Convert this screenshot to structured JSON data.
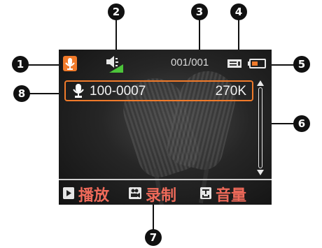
{
  "screen": {
    "counter": "001/001",
    "file": {
      "name": "100-0007",
      "size": "270K"
    }
  },
  "menu": {
    "play_label": "播放",
    "record_label": "录制",
    "volume_label": "音量"
  },
  "callouts": [
    "1",
    "2",
    "3",
    "4",
    "5",
    "6",
    "7",
    "8"
  ],
  "colors": {
    "accent_orange": "#f07a2a",
    "menu_text": "#ef6a5a",
    "volume_green": "#4cc43a"
  }
}
